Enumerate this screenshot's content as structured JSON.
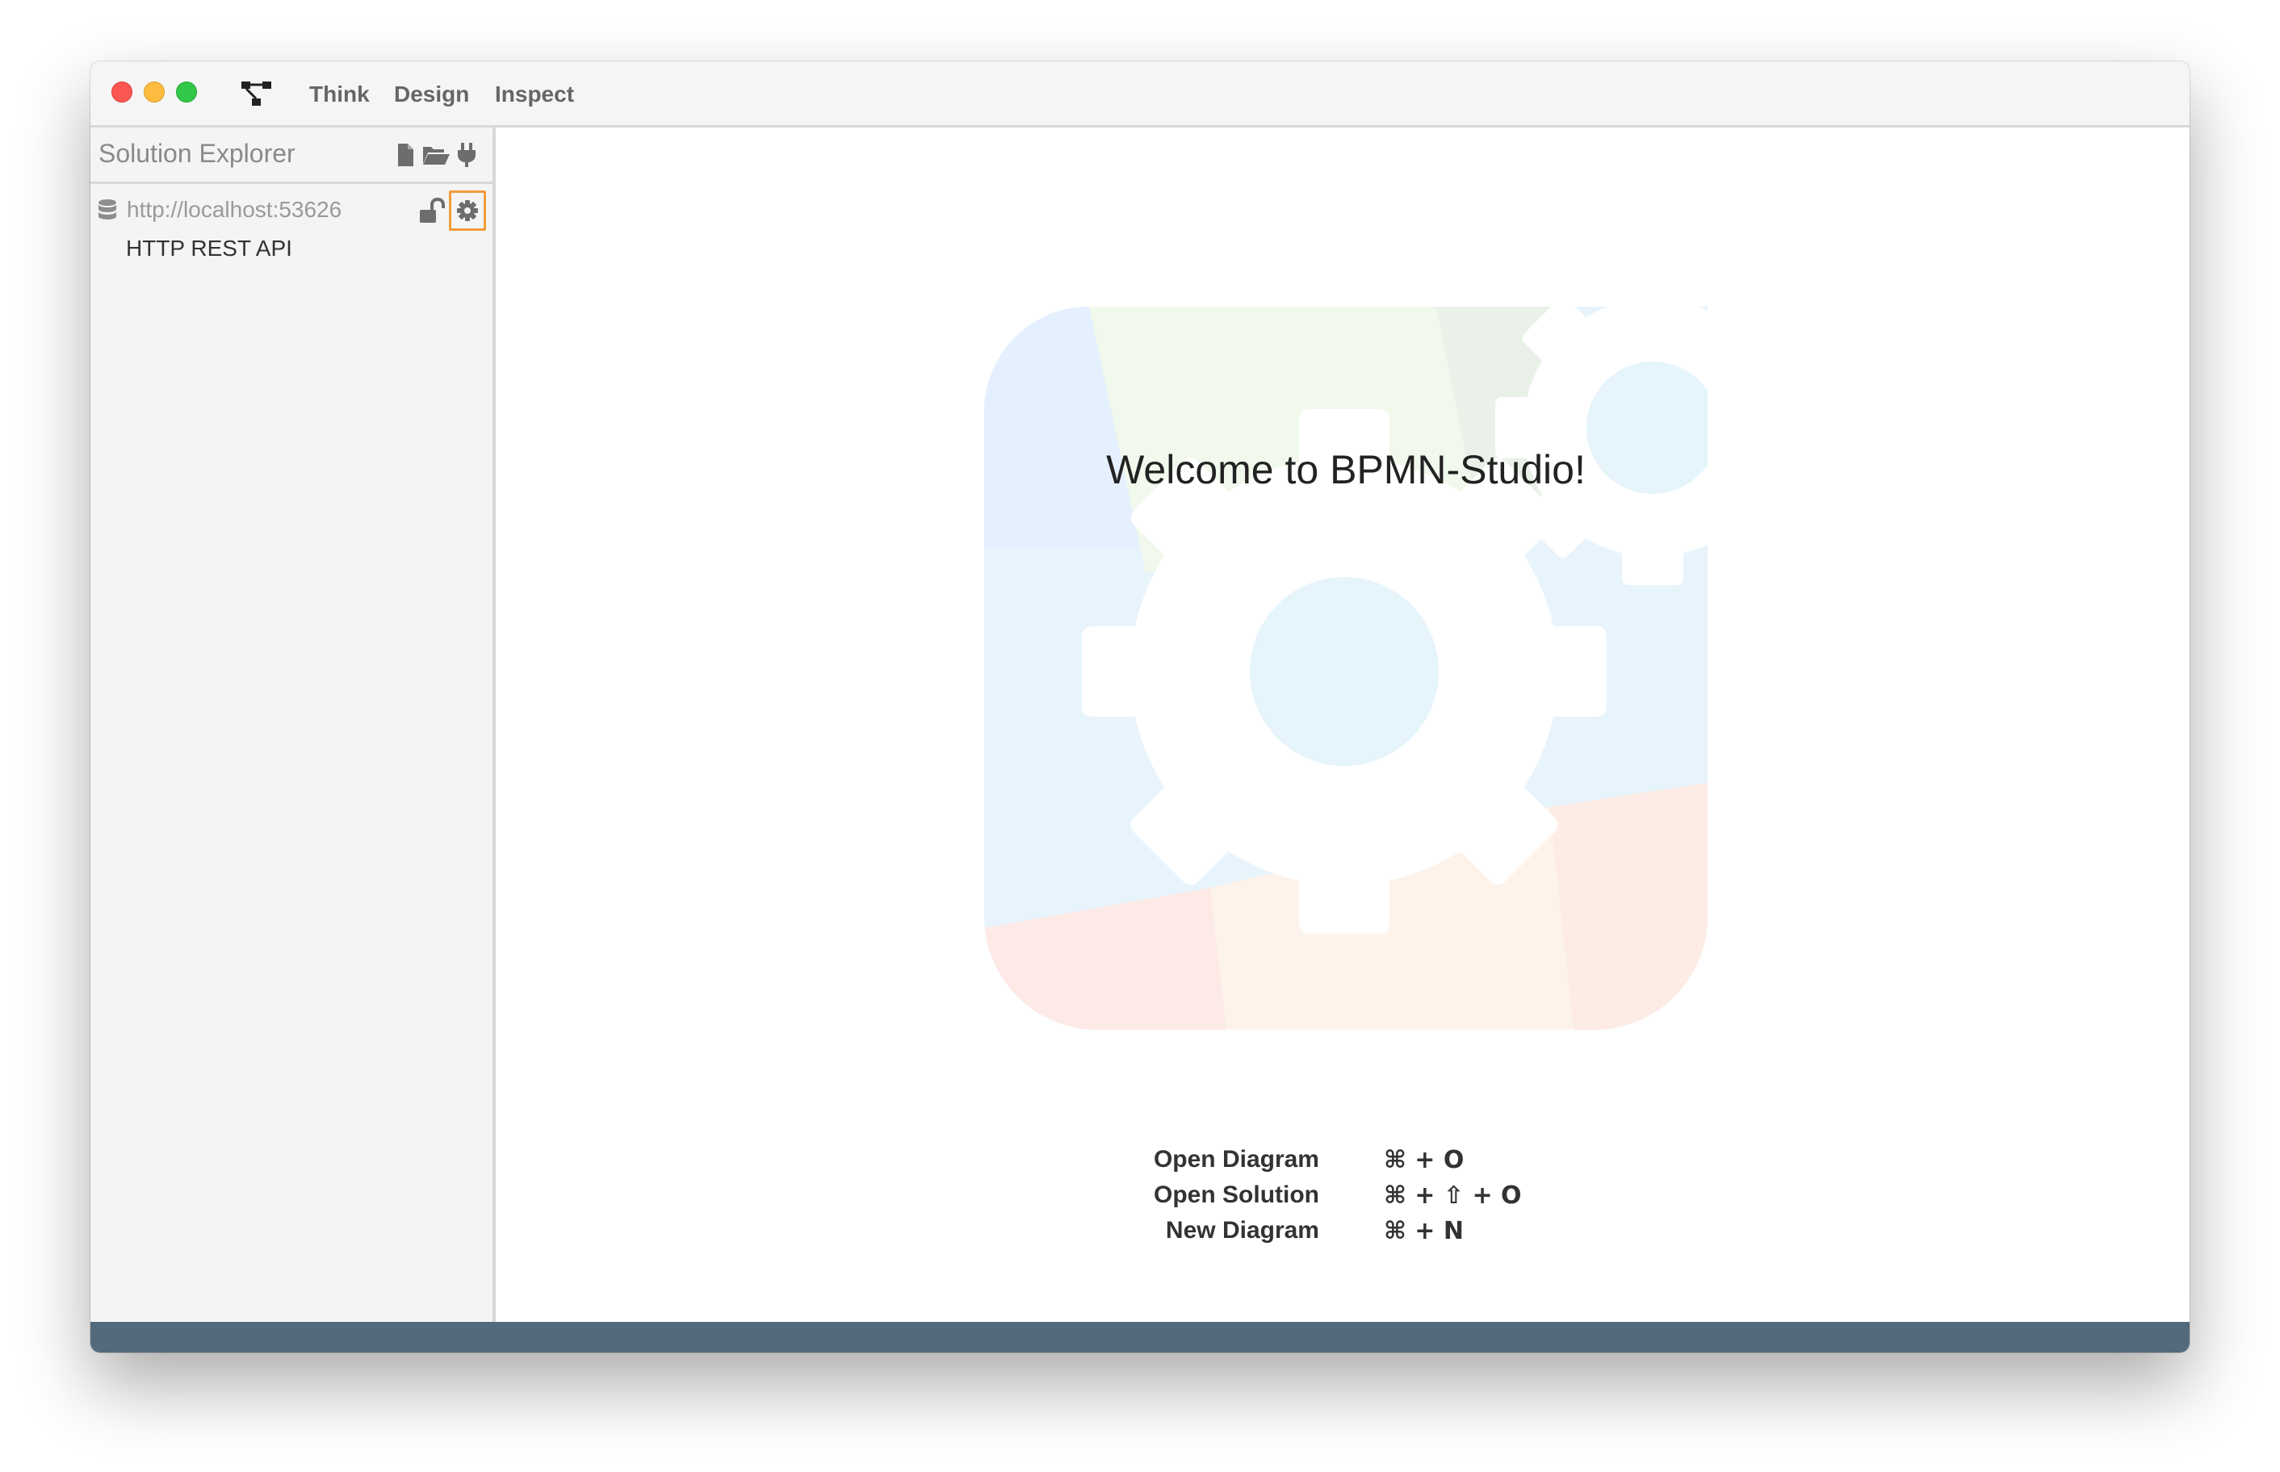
{
  "titlebar": {
    "nav": [
      "Think",
      "Design",
      "Inspect"
    ],
    "logo_icon": "bpmn-studio-logo-icon"
  },
  "sidebar": {
    "title": "Solution Explorer",
    "header_icons": [
      "new-file-icon",
      "open-folder-icon",
      "plug-icon"
    ],
    "solution": {
      "url": "http://localhost:53626",
      "icons": [
        "database-icon",
        "unlocked-icon",
        "gear-icon"
      ],
      "items": [
        "HTTP REST API"
      ]
    }
  },
  "main": {
    "welcome_title": "Welcome to BPMN-Studio!",
    "shortcuts": [
      {
        "label": "Open Diagram",
        "keys": "⌘ + O"
      },
      {
        "label": "Open Solution",
        "keys": "⌘ + ⇧ + O"
      },
      {
        "label": "New Diagram",
        "keys": "⌘ + N"
      }
    ]
  },
  "colors": {
    "accent_highlight": "#f29a3a",
    "statusbar": "#526a7c",
    "traffic_close": "#fc5753",
    "traffic_minimize": "#fdbc40",
    "traffic_maximize": "#33c748"
  }
}
